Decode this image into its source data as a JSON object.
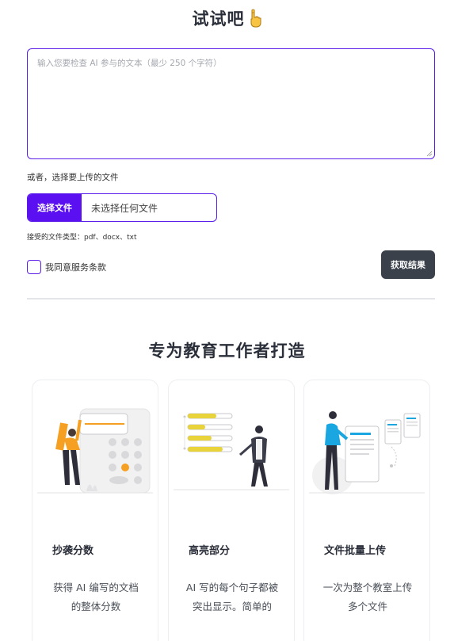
{
  "header": {
    "title": "试试吧"
  },
  "form": {
    "text_placeholder": "输入您要检查 AI 参与的文本（最少 250 个字符）",
    "or_label": "或者，选择要上传的文件",
    "choose_file_label": "选择文件",
    "no_file_label": "未选择任何文件",
    "accepted_types": "接受的文件类型：pdf、docx、txt",
    "agree_label": "我同意服务条款",
    "submit_label": "获取结果"
  },
  "features": {
    "title": "专为教育工作者打造",
    "cards": [
      {
        "title": "抄袭分数",
        "desc": "获得 AI 编写的文档的整体分数",
        "icon": "calculator-illustration"
      },
      {
        "title": "高亮部分",
        "desc": "AI 写的每个句子都被突出显示。简单的",
        "icon": "highlight-illustration"
      },
      {
        "title": "文件批量上传",
        "desc": "一次为整个教室上传多个文件",
        "icon": "documents-illustration"
      }
    ]
  },
  "colors": {
    "accent": "#5a10f0",
    "dark_button": "#3a414b",
    "orange": "#f5a023",
    "cyan": "#1aa6e0",
    "yellow": "#e8d43a"
  }
}
